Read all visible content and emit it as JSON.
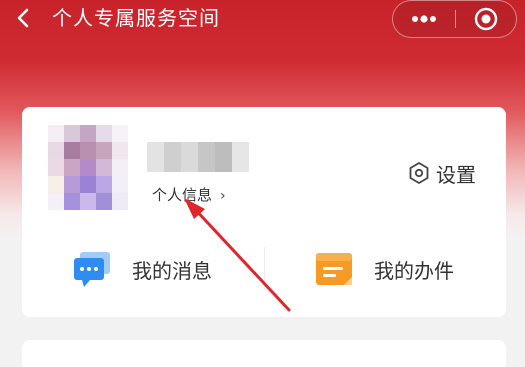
{
  "nav": {
    "title": "个人专属服务空间",
    "icons": [
      "back-arrow-icon",
      "more-dots-icon",
      "close-target-icon"
    ]
  },
  "profile": {
    "link_label": "个人信息",
    "link_chevron": "›",
    "name_obscured": true,
    "avatar_obscured": true
  },
  "settings": {
    "label": "设置",
    "icon": "hexagon-gear-icon"
  },
  "tiles": [
    {
      "label": "我的消息",
      "icon": "message-bubble-icon",
      "color": "#2f8cf0"
    },
    {
      "label": "我的办件",
      "icon": "document-folder-icon",
      "color": "#f59a23"
    }
  ],
  "colors": {
    "brand_red": "#c8222a",
    "annotation_arrow": "#e0262b"
  }
}
